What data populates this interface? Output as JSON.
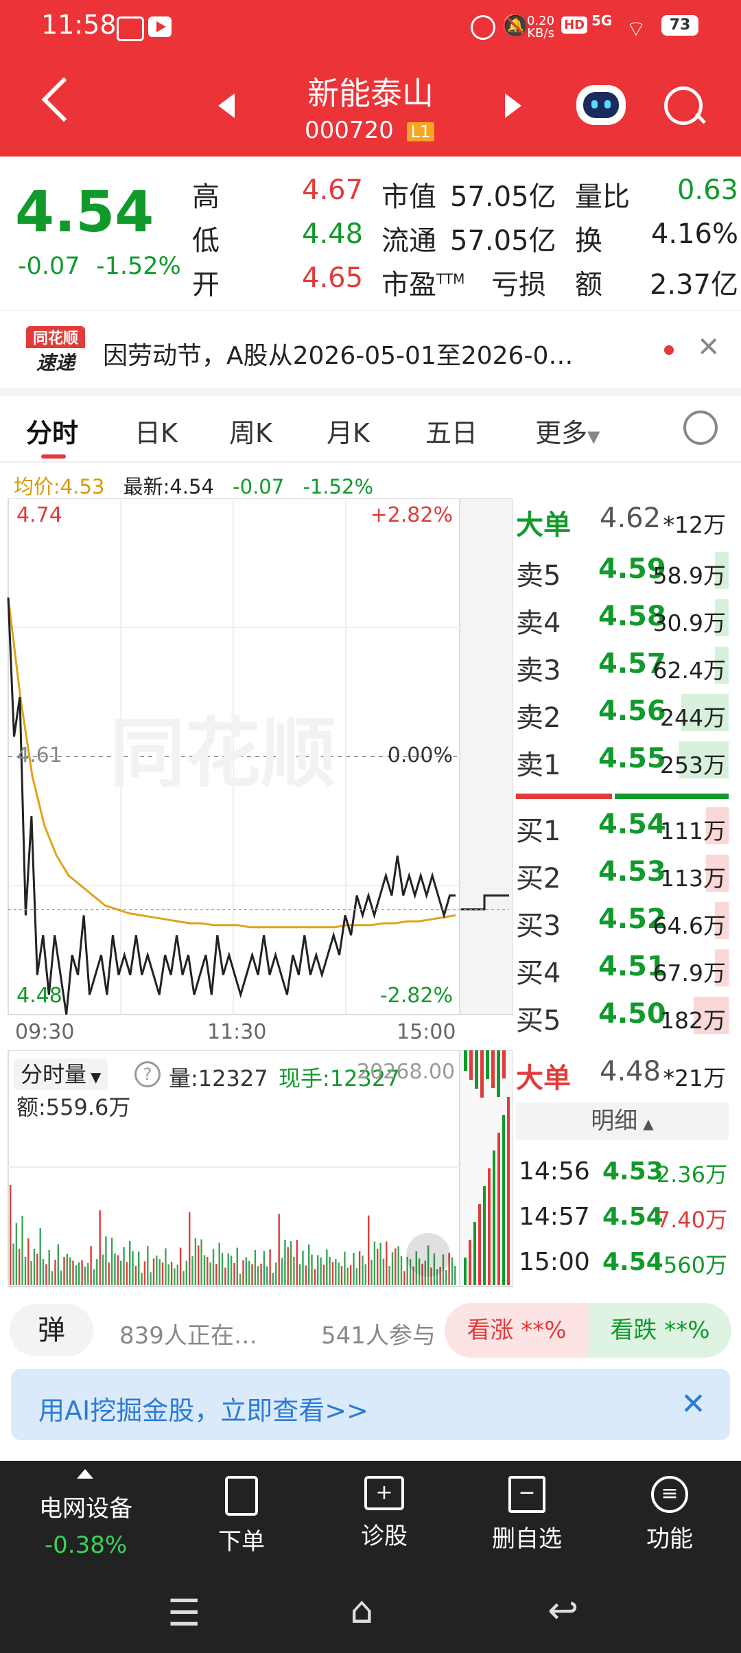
{
  "status": {
    "time": "11:58",
    "net_speed": "0.20",
    "net_unit": "KB/s",
    "hd": "HD",
    "signal": "5G",
    "battery": "73"
  },
  "nav": {
    "name": "新能泰山",
    "code": "000720",
    "level": "L1"
  },
  "quote": {
    "price": "4.54",
    "change": "-0.07",
    "change_pct": "-1.52%",
    "high_label": "高",
    "high": "4.67",
    "low_label": "低",
    "low": "4.48",
    "open_label": "开",
    "open": "4.65",
    "mcap_label": "市值",
    "mcap": "57.05亿",
    "float_label": "流通",
    "float": "57.05亿",
    "pe_label": "市盈",
    "pe_sup": "TTM",
    "pe": "亏损",
    "vr_label": "量比",
    "vr": "0.63",
    "turn_label": "换",
    "turn": "4.16%",
    "amt_label": "额",
    "amt": "2.37亿"
  },
  "news": {
    "logo_top": "同花顺",
    "logo_bottom": "速递",
    "text": "因劳动节，A股从2026-05-01至2026-0…"
  },
  "tabs": [
    "分时",
    "日K",
    "周K",
    "月K",
    "五日",
    "更多"
  ],
  "info": {
    "avg_label": "均价:",
    "avg": "4.53",
    "latest_label": "最新:",
    "latest": "4.54",
    "chg": "-0.07",
    "pct": "-1.52%"
  },
  "chart_data": {
    "type": "line",
    "title": "",
    "x_ticks": [
      "09:30",
      "11:30",
      "15:00"
    ],
    "y_left": {
      "top": "4.74",
      "mid": "4.61",
      "bottom": "4.48"
    },
    "y_right": {
      "top": "+2.82%",
      "mid": "0.00%",
      "bottom": "-2.82%"
    },
    "ylim": [
      4.48,
      4.74
    ],
    "series": [
      {
        "values": [
          4.69,
          4.62,
          4.64,
          4.53,
          4.58,
          4.5,
          4.52,
          4.49,
          4.52,
          4.5,
          4.48,
          4.51,
          4.5,
          4.53,
          4.49,
          4.5,
          4.51,
          4.49,
          4.52,
          4.5,
          4.51,
          4.5,
          4.52,
          4.5,
          4.51,
          4.5,
          4.49,
          4.51,
          4.5,
          4.52,
          4.5,
          4.51,
          4.49,
          4.5,
          4.51,
          4.49,
          4.52,
          4.5,
          4.51,
          4.5,
          4.49,
          4.5,
          4.51,
          4.5,
          4.52,
          4.5,
          4.51,
          4.5,
          4.49,
          4.51,
          4.5,
          4.52,
          4.5,
          4.51,
          4.5,
          4.51,
          4.52,
          4.51,
          4.53,
          4.52,
          4.54,
          4.53,
          4.54,
          4.53,
          4.54,
          4.55,
          4.54,
          4.56,
          4.54,
          4.55,
          4.54,
          4.55,
          4.54,
          4.55,
          4.54,
          4.53,
          4.54,
          4.54
        ]
      },
      {
        "values": [
          4.69,
          4.64,
          4.6,
          4.575,
          4.56,
          4.55,
          4.545,
          4.54,
          4.535,
          4.533,
          4.531,
          4.53,
          4.529,
          4.528,
          4.527,
          4.526,
          4.526,
          4.525,
          4.525,
          4.525,
          4.524,
          4.524,
          4.524,
          4.524,
          4.524,
          4.524,
          4.524,
          4.524,
          4.525,
          4.525,
          4.525,
          4.526,
          4.526,
          4.527,
          4.527,
          4.528,
          4.529,
          4.53
        ]
      }
    ]
  },
  "vol": {
    "label": "分时量",
    "vol_label": "量:",
    "vol": "12327",
    "cur_label": "现手:",
    "cur": "12327",
    "amt_label": "额:",
    "amt": "559.6万",
    "max": "20268.00"
  },
  "book": {
    "big_label": "大单",
    "big_sell_price": "4.62",
    "big_sell_vol": "*12万",
    "asks": [
      {
        "label": "卖5",
        "price": "4.59",
        "vol": "58.9万",
        "w": 0.06
      },
      {
        "label": "卖4",
        "price": "4.58",
        "vol": "30.9万",
        "w": 0.03
      },
      {
        "label": "卖3",
        "price": "4.57",
        "vol": "62.4万",
        "w": 0.06
      },
      {
        "label": "卖2",
        "price": "4.56",
        "vol": "244万",
        "w": 0.23
      },
      {
        "label": "卖1",
        "price": "4.55",
        "vol": "253万",
        "w": 0.24
      }
    ],
    "bids": [
      {
        "label": "买1",
        "price": "4.54",
        "vol": "111万",
        "w": 0.11
      },
      {
        "label": "买2",
        "price": "4.53",
        "vol": "113万",
        "w": 0.11
      },
      {
        "label": "买3",
        "price": "4.52",
        "vol": "64.6万",
        "w": 0.06
      },
      {
        "label": "买4",
        "price": "4.51",
        "vol": "67.9万",
        "w": 0.06
      },
      {
        "label": "买5",
        "price": "4.50",
        "vol": "182万",
        "w": 0.17
      }
    ],
    "big_buy_price": "4.48",
    "big_buy_vol": "*21万",
    "detail_label": "明细",
    "ticks": [
      {
        "time": "14:56",
        "price": "4.53",
        "vol": "2.36万",
        "c": "green"
      },
      {
        "time": "14:57",
        "price": "4.54",
        "vol": "7.40万",
        "c": "red"
      },
      {
        "time": "15:00",
        "price": "4.54",
        "vol": "560万",
        "c": "green"
      }
    ]
  },
  "social": {
    "danmu": "弹",
    "watching": "839人正在…",
    "participants": "541人参与",
    "bull": "看涨 **%",
    "bear": "看跌 **%"
  },
  "ai_banner": {
    "text": "用AI挖掘金股，立即查看>>"
  },
  "bottom": {
    "sector_name": "电网设备",
    "sector_chg": "-0.38%",
    "order": "下单",
    "diagnose": "诊股",
    "remove": "删自选",
    "func": "功能"
  },
  "colors": {
    "header_red": "#eb3338",
    "down_green": "#119a2b",
    "up_red": "#e23b3b",
    "avg_line": "#e0a21b",
    "bottom_bg": "#222222"
  }
}
